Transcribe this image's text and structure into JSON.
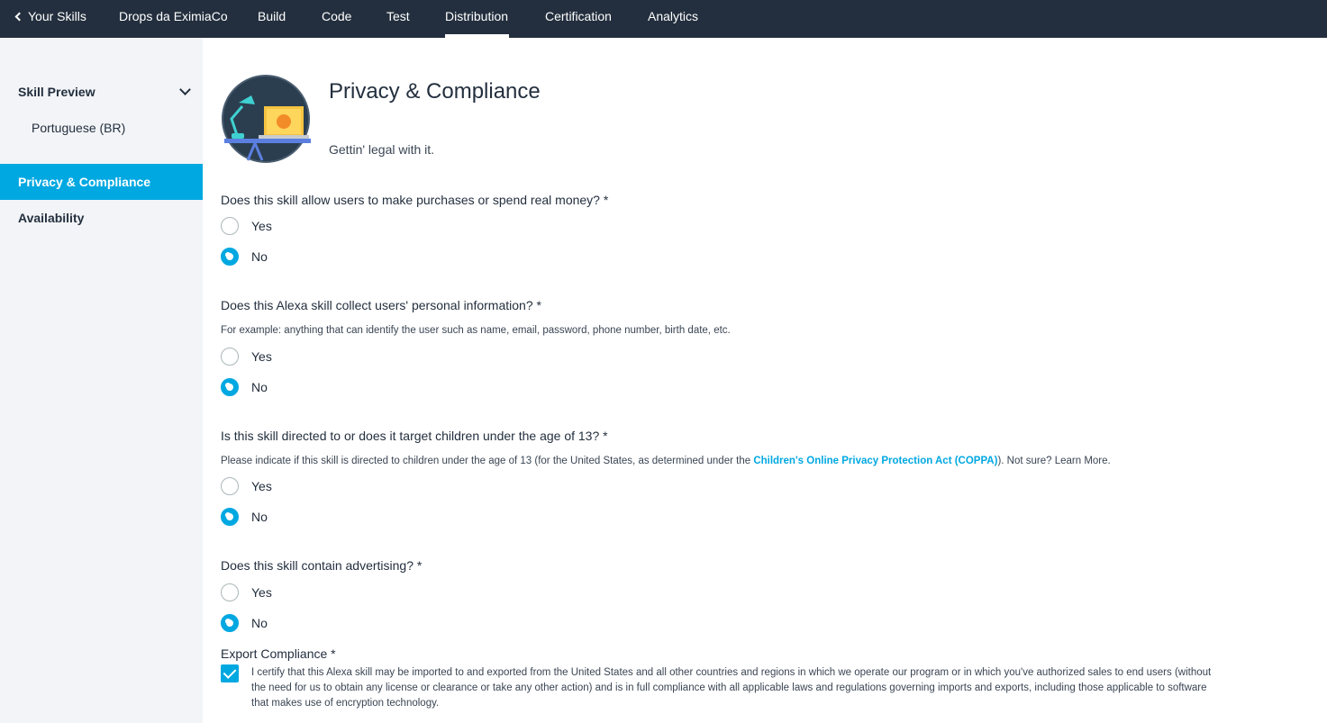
{
  "topnav": {
    "back_label": "Your Skills",
    "items": [
      "Drops da EximiaCo",
      "Build",
      "Code",
      "Test",
      "Distribution",
      "Certification",
      "Analytics"
    ],
    "active": "Distribution"
  },
  "sidebar": {
    "section_label": "Skill Preview",
    "sub_item": "Portuguese (BR)",
    "privacy_label": "Privacy & Compliance",
    "availability_label": "Availability"
  },
  "header": {
    "title": "Privacy & Compliance",
    "subtitle": "Gettin' legal with it."
  },
  "questions": [
    {
      "text": "Does this skill allow users to make purchases or spend real money? *",
      "selected": "No"
    },
    {
      "text": "Does this Alexa skill collect users' personal information? *",
      "hint": "For example: anything that can identify the user such as name, email, password, phone number, birth date, etc.",
      "selected": "No"
    },
    {
      "text": "Is this skill directed to or does it target children under the age of 13? *",
      "hint_before": "Please indicate if this skill is directed to children under the age of 13 (for the United States, as determined under the ",
      "hint_link": "Children's Online Privacy Protection Act (COPPA)",
      "hint_after": "). Not sure? Learn More.",
      "selected": "No"
    },
    {
      "text": "Does this skill contain advertising? *",
      "selected": "No"
    }
  ],
  "options": {
    "yes": "Yes",
    "no": "No"
  },
  "export": {
    "label": "Export Compliance *",
    "checked": true,
    "text": "I certify that this Alexa skill may be imported to and exported from the United States and all other countries and regions in which we operate our program or in which you've authorized sales to end users (without the need for us to obtain any license or clearance or take any other action) and is in full compliance with all applicable laws and regulations governing imports and exports, including those applicable to software that makes use of encryption technology."
  },
  "colors": {
    "nav_bg": "#232f3e",
    "accent": "#00a8e1",
    "sidebar_bg": "#f2f4f7"
  }
}
